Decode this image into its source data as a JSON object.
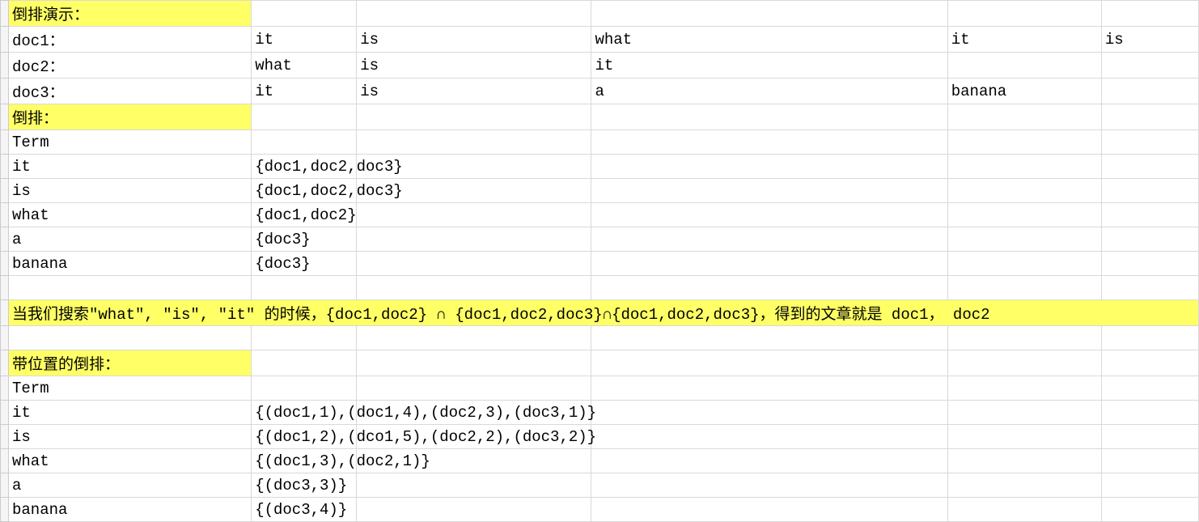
{
  "rows": [
    {
      "hl": "A",
      "cells": [
        "倒排演示：",
        "",
        "",
        "",
        "",
        ""
      ]
    },
    {
      "cells": [
        "doc1：",
        "it",
        "is",
        "what",
        "it",
        "is"
      ]
    },
    {
      "cells": [
        "doc2：",
        "what",
        "is",
        "it",
        "",
        ""
      ]
    },
    {
      "cells": [
        "doc3：",
        "it",
        "is",
        "a",
        "banana",
        ""
      ]
    },
    {
      "hl": "A",
      "cells": [
        "倒排：",
        "",
        "",
        "",
        "",
        ""
      ]
    },
    {
      "cells": [
        "Term",
        "",
        "",
        "",
        "",
        ""
      ]
    },
    {
      "cells": [
        "it",
        "{doc1,doc2,doc3}",
        "",
        "",
        "",
        ""
      ]
    },
    {
      "cells": [
        "is",
        "{doc1,doc2,doc3}",
        "",
        "",
        "",
        ""
      ]
    },
    {
      "cells": [
        "what",
        "{doc1,doc2}",
        "",
        "",
        "",
        ""
      ]
    },
    {
      "cells": [
        "a",
        "{doc3}",
        "",
        "",
        "",
        ""
      ]
    },
    {
      "cells": [
        "banana",
        "{doc3}",
        "",
        "",
        "",
        ""
      ]
    },
    {
      "cells": [
        "",
        "",
        "",
        "",
        "",
        ""
      ]
    },
    {
      "hl": "ALL",
      "merged": "当我们搜索\"what\", \"is\", \"it\" 的时候，{doc1,doc2} ∩  {doc1,doc2,doc3}∩{doc1,doc2,doc3}，得到的文章就是 doc1， doc2"
    },
    {
      "cells": [
        "",
        "",
        "",
        "",
        "",
        ""
      ]
    },
    {
      "hl": "A",
      "cells": [
        "带位置的倒排：",
        "",
        "",
        "",
        "",
        ""
      ]
    },
    {
      "cells": [
        "Term",
        "",
        "",
        "",
        "",
        ""
      ]
    },
    {
      "cells": [
        "it",
        "{(doc1,1),(doc1,4),(doc2,3),(doc3,1)}",
        "",
        "",
        "",
        ""
      ]
    },
    {
      "cells": [
        "is",
        "{(doc1,2),(dco1,5),(doc2,2),(doc3,2)}",
        "",
        "",
        "",
        ""
      ]
    },
    {
      "cells": [
        "what",
        "{(doc1,3),(doc2,1)}",
        "",
        "",
        "",
        ""
      ]
    },
    {
      "cells": [
        "a",
        "{(doc3,3)}",
        "",
        "",
        "",
        ""
      ]
    },
    {
      "cells": [
        "banana",
        "{(doc3,4)}",
        "",
        "",
        "",
        ""
      ]
    }
  ],
  "colClasses": [
    "colA",
    "colB",
    "colC",
    "colD",
    "colE",
    "colF"
  ]
}
